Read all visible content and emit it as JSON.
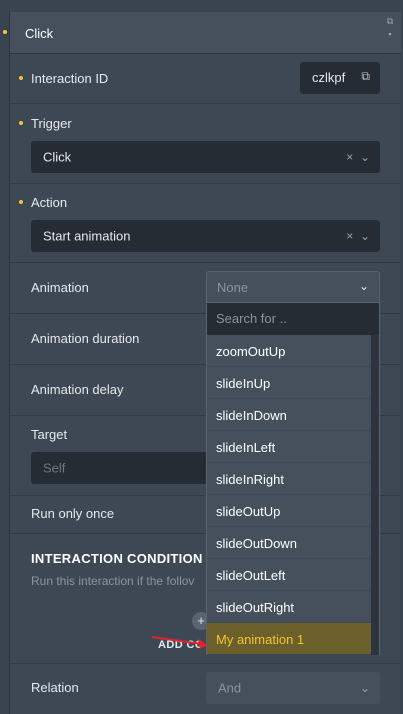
{
  "header": {
    "title": "Click",
    "copy_icon": "copy-icon",
    "delete_icon": "trash-icon"
  },
  "interaction_id": {
    "label": "Interaction ID",
    "value": "czlkpf",
    "icon": "copy-icon"
  },
  "trigger": {
    "label": "Trigger",
    "value": "Click",
    "clear": "×",
    "chevron": "⌄"
  },
  "action": {
    "label": "Action",
    "value": "Start animation",
    "clear": "×",
    "chevron": "⌄"
  },
  "animation": {
    "label": "Animation",
    "selected": "None",
    "chevron": "⌄",
    "search_placeholder": "Search for ..",
    "options": [
      "zoomOutUp",
      "slideInUp",
      "slideInDown",
      "slideInLeft",
      "slideInRight",
      "slideOutUp",
      "slideOutDown",
      "slideOutLeft",
      "slideOutRight",
      "My animation 1"
    ],
    "highlighted": "My animation 1"
  },
  "animation_duration": {
    "label": "Animation duration"
  },
  "animation_delay": {
    "label": "Animation delay"
  },
  "target": {
    "label": "Target",
    "value": "Self"
  },
  "run_only_once": {
    "label": "Run only once"
  },
  "conditions": {
    "title": "INTERACTION CONDITION",
    "description": "Run this interaction if the follov",
    "add_label": "ADD CO",
    "plus": "+"
  },
  "relation": {
    "label": "Relation",
    "value": "And",
    "chevron": "⌄"
  },
  "colors": {
    "accent": "#f4c531",
    "panel": "#3e4855",
    "field": "#262c33",
    "arrow": "#e0242b"
  }
}
